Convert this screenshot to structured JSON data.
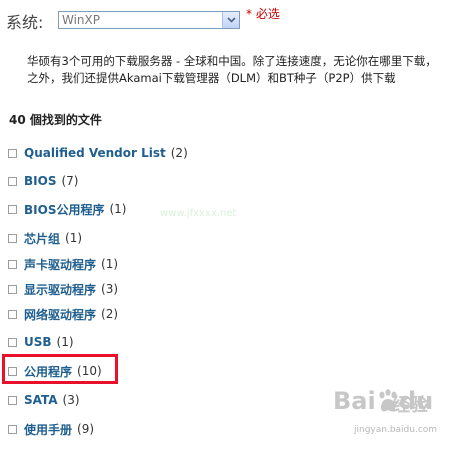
{
  "os_filter": {
    "label": "系统:",
    "selected": "WinXP",
    "required_note": "* 必选"
  },
  "description": {
    "line1": "华硕有3个可用的下载服务器 - 全球和中国。除了连接速度，无论你在哪里下载，",
    "line2": "之外，我们还提供Akamai下载管理器（DLM）和BT种子（P2P）供下载"
  },
  "results_title": "40 個找到的文件",
  "items": [
    {
      "name": "Qualified Vendor List",
      "count": "(2)"
    },
    {
      "name": "BIOS",
      "count": "(7)"
    },
    {
      "name": "BIOS公用程序",
      "count": "(1)"
    },
    {
      "name": "芯片组",
      "count": "(1)"
    },
    {
      "name": "声卡驱动程序",
      "count": "(1)"
    },
    {
      "name": "显示驱动程序",
      "count": "(3)"
    },
    {
      "name": "网络驱动程序",
      "count": "(2)"
    },
    {
      "name": "USB",
      "count": "(1)"
    },
    {
      "name": "公用程序",
      "count": "(10)"
    },
    {
      "name": "SATA",
      "count": "(3)"
    },
    {
      "name": "使用手册",
      "count": "(9)"
    }
  ],
  "watermark": {
    "brand": "Bai",
    "brand_suffix": "du",
    "jingyan": "经验",
    "url": "jingyan.baidu.com",
    "center": "www.jfxxxx.net"
  },
  "colors": {
    "link": "#1f5f8f",
    "required": "#cc0000",
    "highlight_border": "#e8102a"
  },
  "icons": {
    "dropdown": "chevron-down-icon",
    "paw": "baidu-paw-icon"
  }
}
